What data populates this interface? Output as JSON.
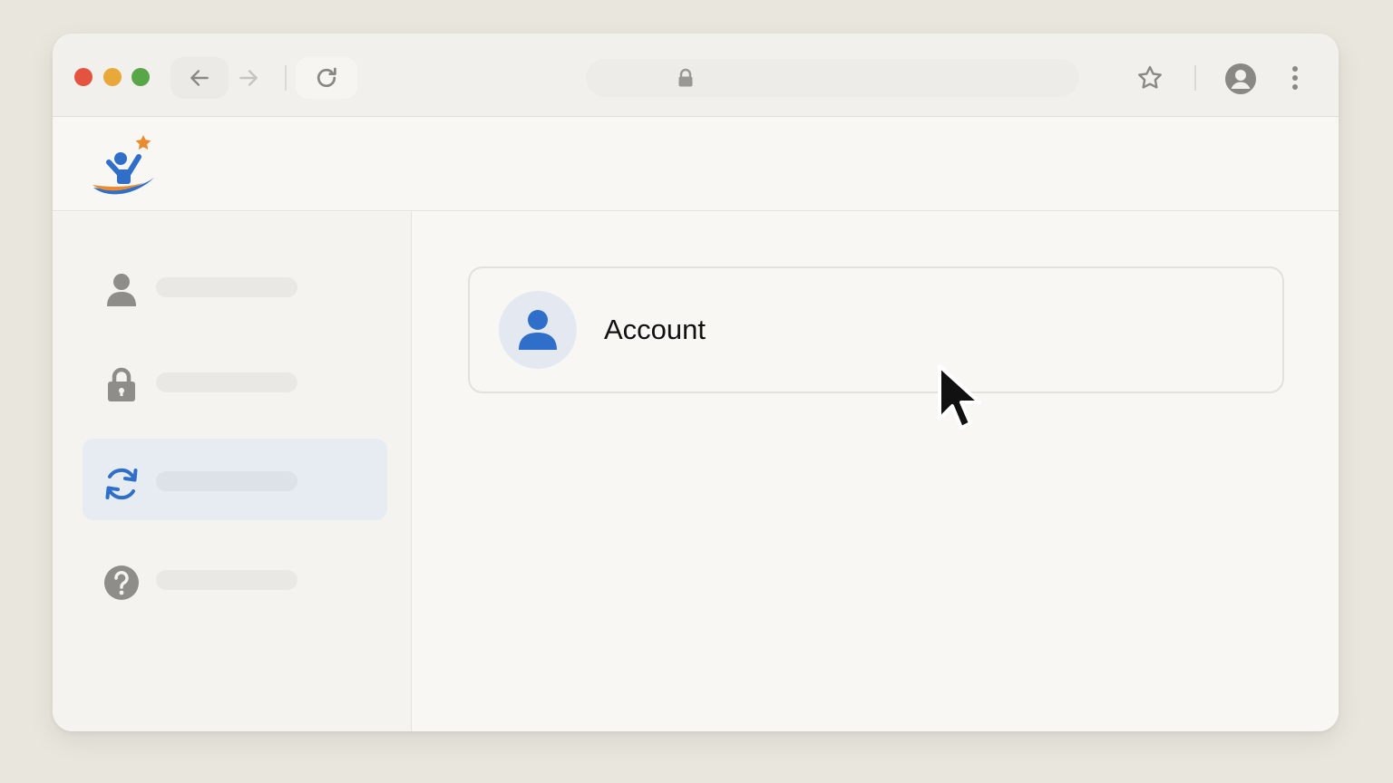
{
  "browser": {
    "traffic_lights": {
      "close": "#e3533f",
      "minimize": "#e8a93a",
      "maximize": "#58a648"
    },
    "toolbar_icons": [
      "back-arrow-icon",
      "forward-arrow-icon",
      "reload-icon",
      "lock-icon",
      "star-icon",
      "profile-icon",
      "kebab-menu-icon"
    ]
  },
  "app": {
    "logo_icon": "person-star-logo-icon"
  },
  "sidebar": {
    "items": [
      {
        "icon": "person-icon",
        "active": false
      },
      {
        "icon": "lock-icon",
        "active": false
      },
      {
        "icon": "sync-icon",
        "active": true
      },
      {
        "icon": "help-icon",
        "active": false
      }
    ]
  },
  "main": {
    "card": {
      "title": "Account",
      "icon": "person-icon"
    }
  },
  "colors": {
    "accent_blue": "#2f6fc9",
    "logo_orange": "#e98b2e",
    "active_bg": "#e7ecf3"
  }
}
